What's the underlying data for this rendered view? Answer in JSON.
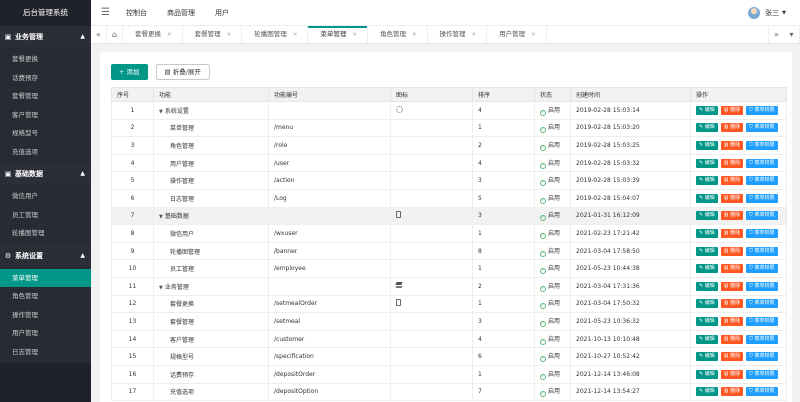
{
  "app_title": "后台管理系统",
  "sidebar": {
    "groups": [
      {
        "icon": "monitor-icon",
        "label": "业务管理",
        "items": [
          "套餐更换",
          "话费预存",
          "套餐管理",
          "客户管理",
          "规格型号",
          "充值选项"
        ]
      },
      {
        "icon": "monitor-icon",
        "label": "基础数据",
        "items": [
          "微信用户",
          "员工管理",
          "轮播图管理"
        ]
      },
      {
        "icon": "gear-icon",
        "label": "系统设置",
        "items": [
          "菜单管理",
          "角色管理",
          "操作管理",
          "用户管理",
          "日志管理"
        ],
        "active_index": 0
      }
    ]
  },
  "header": {
    "nav": [
      "控制台",
      "商品管理",
      "用户"
    ],
    "user_name": "张三"
  },
  "tabs": {
    "items": [
      "套餐更换",
      "套餐管理",
      "轮播图管理",
      "菜单管理",
      "角色管理",
      "操作管理",
      "用户管理"
    ],
    "active_index": 3
  },
  "toolbar": {
    "add_label": "+ 添加",
    "fold_label": "折叠/展开"
  },
  "table": {
    "headers": [
      "序号",
      "功能",
      "功能编号",
      "图标",
      "排序",
      "状态",
      "创建时间",
      "操作"
    ],
    "op_labels": {
      "edit": "编辑",
      "delete": "删除",
      "perm": "菜单权限"
    },
    "status_label": "启用",
    "rows": [
      {
        "no": "1",
        "name": "系统设置",
        "level": 0,
        "code": "",
        "icon": "gear",
        "sort": "4",
        "time": "2019-02-28 15:03:14"
      },
      {
        "no": "2",
        "name": "菜单管理",
        "level": 1,
        "code": "/menu",
        "icon": "",
        "sort": "1",
        "time": "2019-02-28 15:03:20"
      },
      {
        "no": "3",
        "name": "角色管理",
        "level": 1,
        "code": "/role",
        "icon": "",
        "sort": "2",
        "time": "2019-02-28 15:03:25"
      },
      {
        "no": "4",
        "name": "用户管理",
        "level": 1,
        "code": "/user",
        "icon": "",
        "sort": "4",
        "time": "2019-02-28 15:03:32"
      },
      {
        "no": "5",
        "name": "操作管理",
        "level": 1,
        "code": "/action",
        "icon": "",
        "sort": "3",
        "time": "2019-02-28 15:03:39"
      },
      {
        "no": "6",
        "name": "日志管理",
        "level": 1,
        "code": "/Log",
        "icon": "",
        "sort": "5",
        "time": "2019-02-28 15:04:07"
      },
      {
        "no": "7",
        "name": "基础数据",
        "level": 0,
        "code": "",
        "icon": "phone",
        "sort": "3",
        "time": "2021-01-31 16:12:09"
      },
      {
        "no": "8",
        "name": "微信用户",
        "level": 1,
        "code": "/wxuser",
        "icon": "",
        "sort": "1",
        "time": "2021-02-23 17:21:42"
      },
      {
        "no": "9",
        "name": "轮播图管理",
        "level": 1,
        "code": "/banner",
        "icon": "",
        "sort": "8",
        "time": "2021-03-04 17:58:50"
      },
      {
        "no": "10",
        "name": "员工管理",
        "level": 1,
        "code": "/employee",
        "icon": "",
        "sort": "1",
        "time": "2021-05-23 10:44:38"
      },
      {
        "no": "11",
        "name": "业务管理",
        "level": 0,
        "code": "",
        "icon": "stack",
        "sort": "2",
        "time": "2021-03-04 17:31:36"
      },
      {
        "no": "12",
        "name": "套餐更换",
        "level": 1,
        "code": "/setmealOrder",
        "icon": "phone",
        "sort": "1",
        "time": "2021-03-04 17:50:32"
      },
      {
        "no": "13",
        "name": "套餐管理",
        "level": 1,
        "code": "/setmeal",
        "icon": "",
        "sort": "3",
        "time": "2021-05-23 10:36:32"
      },
      {
        "no": "14",
        "name": "客户管理",
        "level": 1,
        "code": "/customer",
        "icon": "",
        "sort": "4",
        "time": "2021-10-13 10:10:48"
      },
      {
        "no": "15",
        "name": "规格型号",
        "level": 1,
        "code": "/specification",
        "icon": "",
        "sort": "6",
        "time": "2021-10-27 10:52:42"
      },
      {
        "no": "16",
        "name": "话费预存",
        "level": 1,
        "code": "/depositOrder",
        "icon": "",
        "sort": "1",
        "time": "2021-12-14 13:46:08"
      },
      {
        "no": "17",
        "name": "充值选项",
        "level": 1,
        "code": "/depositOption",
        "icon": "",
        "sort": "7",
        "time": "2021-12-14 13:54:27"
      }
    ]
  }
}
